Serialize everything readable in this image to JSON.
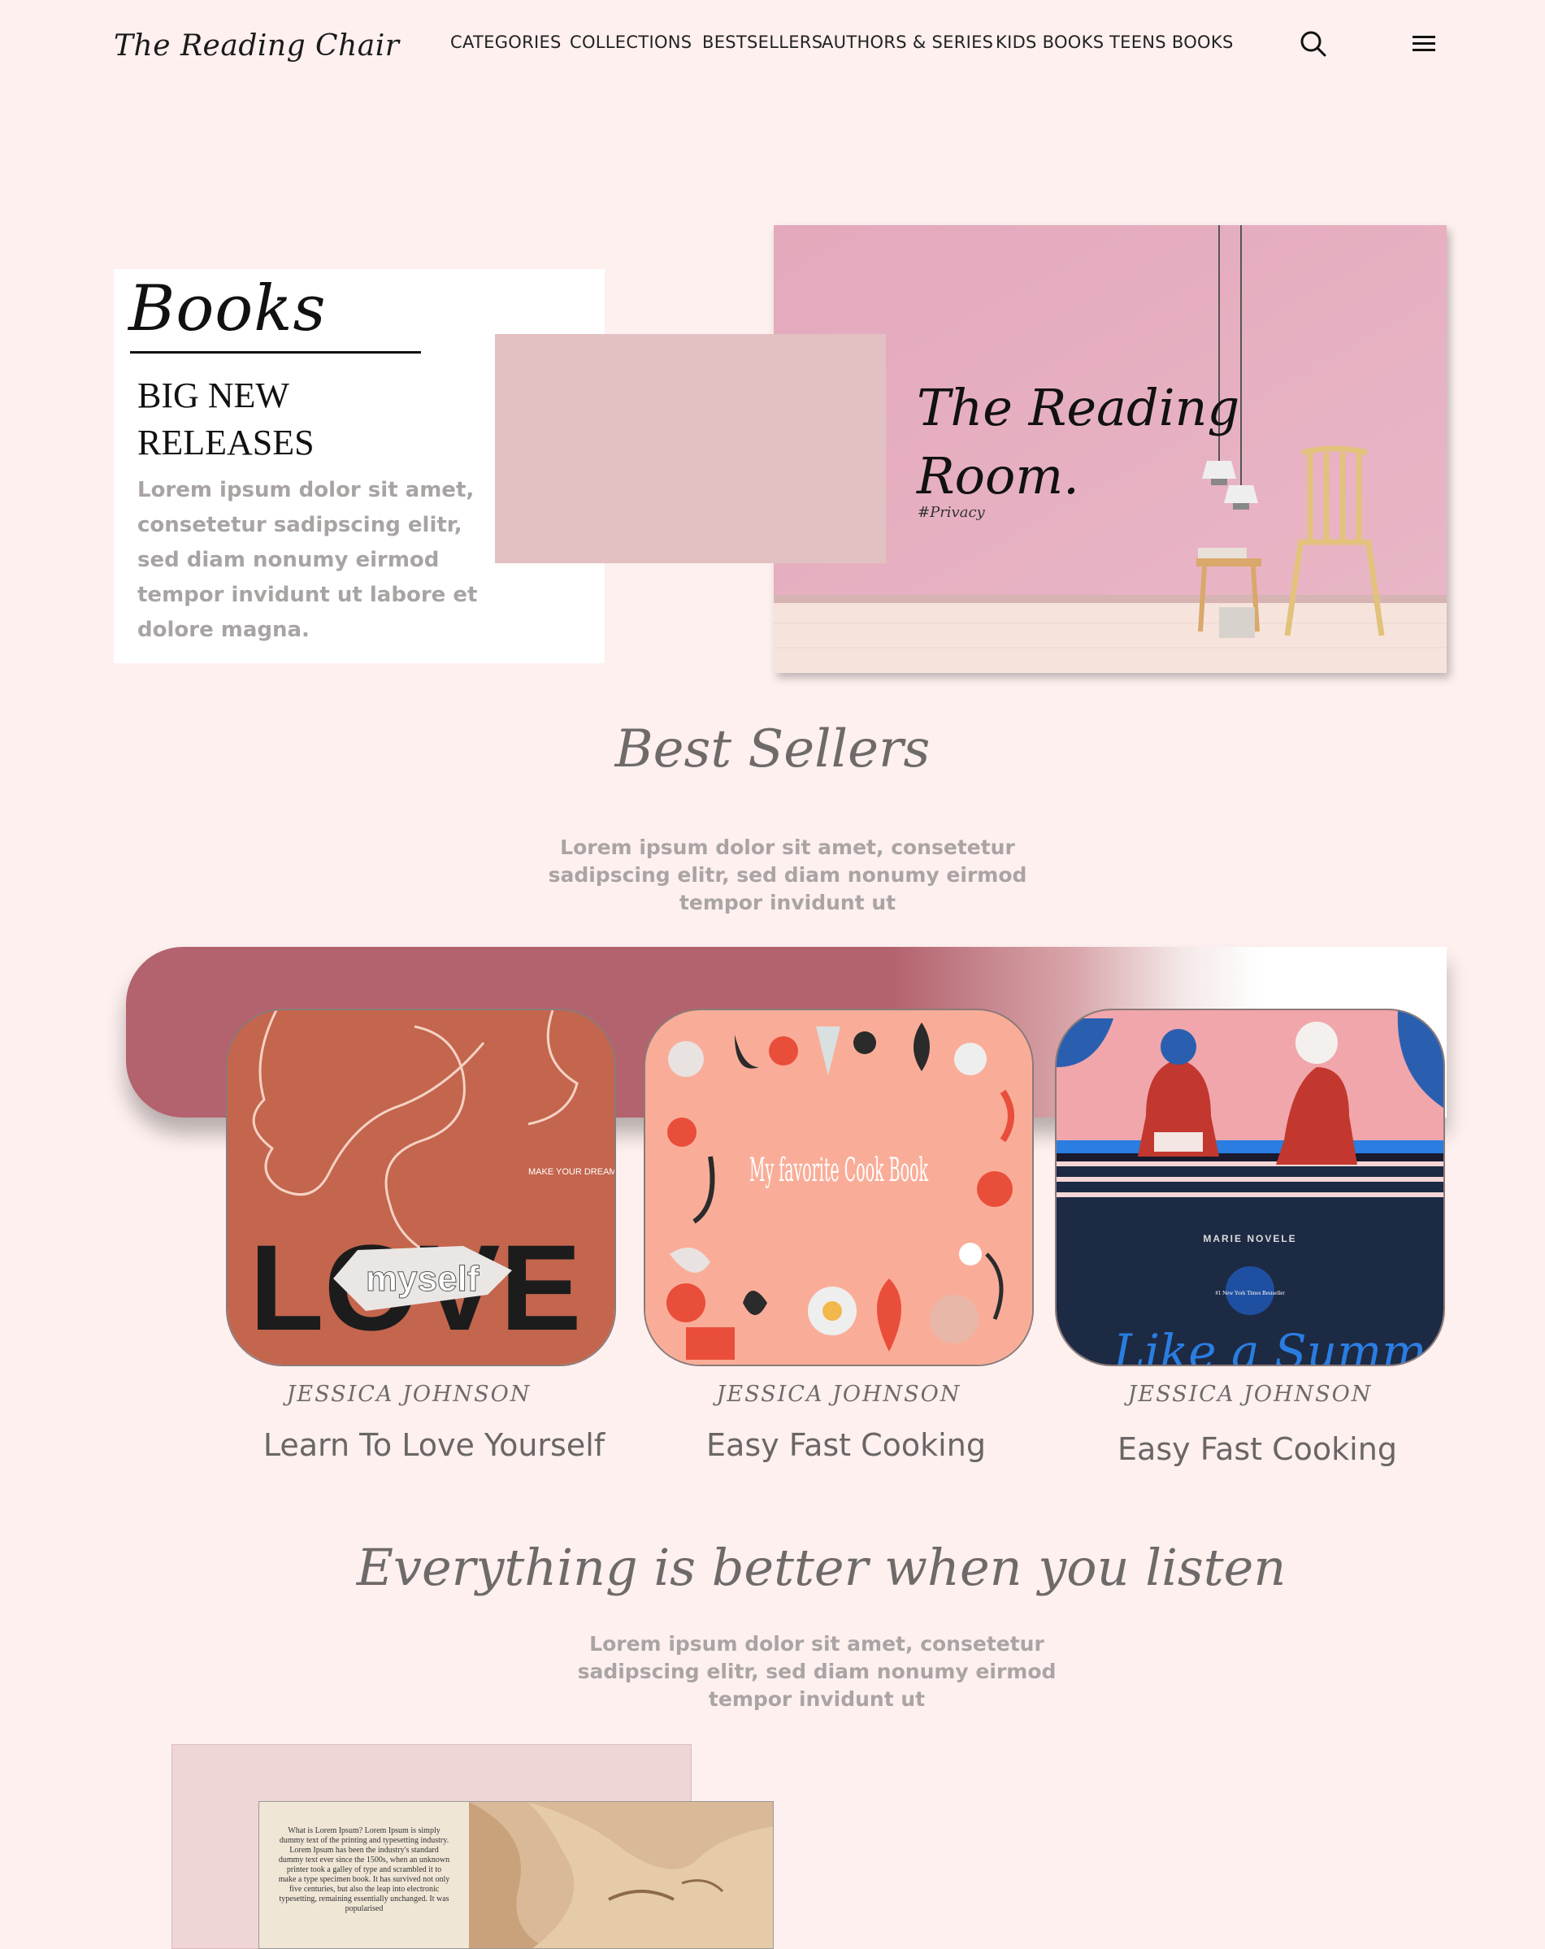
{
  "header": {
    "logo": "The Reading Chair",
    "nav": [
      "CATEGORIES",
      "COLLECTIONS",
      "BESTSELLERS",
      "AUTHORS & SERIES",
      "KIDS BOOKS",
      "TEENS BOOKS"
    ],
    "search_icon": "search-icon",
    "menu_icon": "hamburger-menu-icon"
  },
  "hero": {
    "title": "Books",
    "subtitle": "BIG NEW RELEASES",
    "body": "Lorem ipsum dolor sit amet, consetetur sadipscing elitr, sed diam nonumy eirmod tempor invidunt ut labore et dolore magna.",
    "room_title": "The Reading Room.",
    "room_tag": "#Privacy"
  },
  "bestsellers": {
    "title": "Best Sellers",
    "text": "Lorem ipsum dolor sit amet, consetetur sadipscing elitr, sed diam nonumy eirmod tempor invidunt ut",
    "books": [
      {
        "author": "JESSICA JOHNSON",
        "title": "Learn To Love Yourself",
        "cover_big": "LOVE",
        "cover_small": "myself",
        "cover_tag": "MAKE YOUR DREAMS COME TRUE"
      },
      {
        "author": "JESSICA JOHNSON",
        "title": "Easy Fast Cooking",
        "cover_big": "My favorite Cook Book"
      },
      {
        "author": "JESSICA JOHNSON",
        "title": "Easy Fast Cooking",
        "cover_author": "MARIE NOVELE",
        "cover_badge": "#1 New York Times Bestseller",
        "cover_big": "Like a Summer"
      }
    ]
  },
  "listen": {
    "title": "Everything is better when you listen",
    "text": "Lorem ipsum dolor sit amet, consetetur sadipscing elitr, sed diam nonumy eirmod tempor invidunt ut",
    "page_text": "What is Lorem Ipsum? Lorem Ipsum is simply dummy text of the printing and typesetting industry. Lorem Ipsum has been the industry's standard dummy text ever since the 1500s, when an unknown printer took a galley of type and scrambled it to make a type specimen book. It has survived not only five centuries, but also the leap into electronic typesetting, remaining essentially unchanged. It was popularised"
  }
}
